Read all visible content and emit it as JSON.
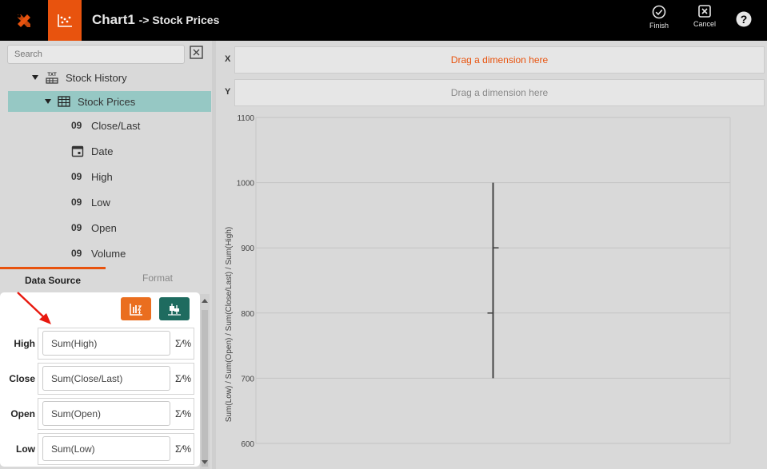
{
  "header": {
    "title": "Chart1",
    "subtitle": "-> Stock Prices",
    "finish_label": "Finish",
    "cancel_label": "Cancel",
    "help_glyph": "?"
  },
  "colors": {
    "brand_orange": "#e8530e",
    "selected_row": "#96c8c4",
    "teal_button": "#1e6b5f",
    "highlight_text": "#e8530e"
  },
  "search": {
    "placeholder": "Search"
  },
  "tree": {
    "parent": {
      "label": "Stock History",
      "icon": "txt-file-icon"
    },
    "selected": {
      "label": "Stock Prices",
      "icon": "table-icon"
    },
    "fields": [
      {
        "type": "09",
        "label": "Close/Last"
      },
      {
        "type": "date-icon",
        "label": "Date"
      },
      {
        "type": "09",
        "label": "High"
      },
      {
        "type": "09",
        "label": "Low"
      },
      {
        "type": "09",
        "label": "Open"
      },
      {
        "type": "09",
        "label": "Volume"
      }
    ]
  },
  "tabs": {
    "data_source": "Data Source",
    "format": "Format"
  },
  "datasource": {
    "fields": [
      {
        "label": "High",
        "value": "Sum(High)"
      },
      {
        "label": "Close",
        "value": "Sum(Close/Last)"
      },
      {
        "label": "Open",
        "value": "Sum(Open)"
      },
      {
        "label": "Low",
        "value": "Sum(Low)"
      }
    ],
    "sigma_label": "Σ⁄%"
  },
  "dropzones": {
    "x_label": "X",
    "x_text": "Drag a dimension here",
    "y_label": "Y",
    "y_text": "Drag a dimension here"
  },
  "chart_data": {
    "type": "candlestick",
    "ylabel": "Sum(Low) / Sum(Open) / Sum(Close/Last) / Sum(High)",
    "ylim": [
      600,
      1100
    ],
    "yticks": [
      "1100",
      "1000",
      "900",
      "800",
      "700",
      "600"
    ],
    "grid": true,
    "series": [
      {
        "low": 700,
        "open": 800,
        "close": 900,
        "high": 1000
      }
    ]
  }
}
